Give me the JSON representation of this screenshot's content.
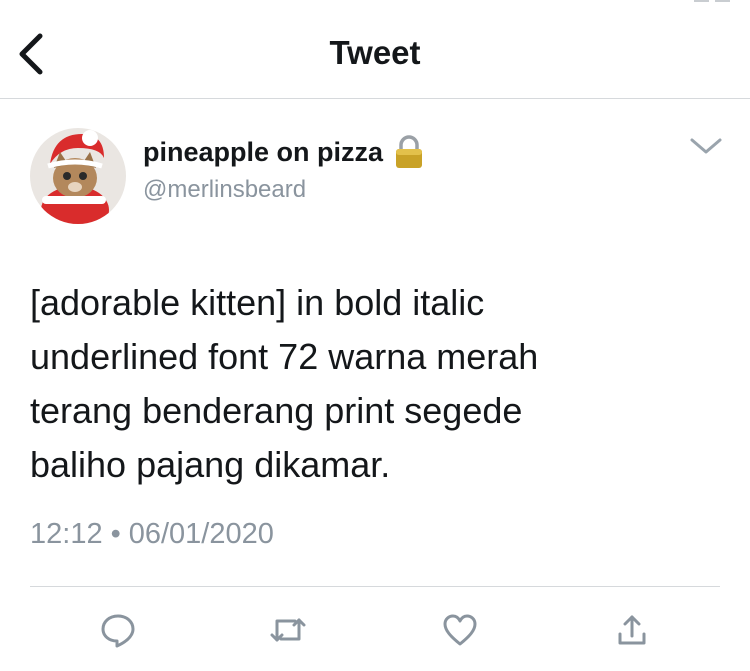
{
  "header": {
    "title": "Tweet",
    "back_icon": "chevron-left-icon"
  },
  "tweet": {
    "author": {
      "display_name": "pineapple on pizza",
      "handle": "@merlinsbeard",
      "protected_icon": "lock-icon",
      "avatar_description_icon": "avatar-kitten"
    },
    "menu_icon": "chevron-down-icon",
    "text": "[adorable kitten] in bold italic\nunderlined font 72 warna merah\nterang benderang print segede\nbaliho pajang dikamar.",
    "time": "12:12",
    "separator": "•",
    "date": "06/01/2020"
  },
  "actions": [
    {
      "name": "reply",
      "icon": "reply-icon"
    },
    {
      "name": "retweet",
      "icon": "retweet-icon"
    },
    {
      "name": "like",
      "icon": "heart-icon"
    },
    {
      "name": "share",
      "icon": "share-icon"
    }
  ],
  "colors": {
    "text": "#14171a",
    "secondary": "#8a949e",
    "icon": "#8a949e",
    "divider": "#d6d9dc",
    "lock": "#c9a227"
  }
}
